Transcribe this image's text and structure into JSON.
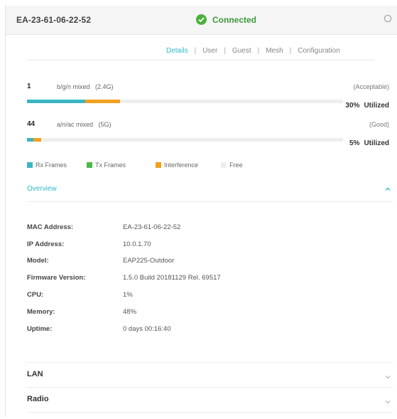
{
  "header": {
    "device_name": "EA-23-61-06-22-52",
    "status": "Connected",
    "status_color": "#4ab03a"
  },
  "tabs": [
    {
      "label": "Details",
      "active": true
    },
    {
      "label": "User",
      "active": false
    },
    {
      "label": "Guest",
      "active": false
    },
    {
      "label": "Mesh",
      "active": false
    },
    {
      "label": "Configuration",
      "active": false
    }
  ],
  "radios": [
    {
      "channel": "1",
      "mode": "b/g/n mixed",
      "band": "(2.4G)",
      "quality": "(Acceptable)",
      "utilization": "30%",
      "utilized_label": "Utilized",
      "rx_fraction": 0.185,
      "tx_fraction": 0.0,
      "interference_fraction": 0.11
    },
    {
      "channel": "44",
      "mode": "a/n/ac mixed",
      "band": "(5G)",
      "quality": "(Good)",
      "utilization": "5%",
      "utilized_label": "Utilized",
      "rx_fraction": 0.02,
      "tx_fraction": 0.0,
      "interference_fraction": 0.025
    }
  ],
  "legend": [
    {
      "label": "Rx Frames",
      "color": "#3bb5c4"
    },
    {
      "label": "Tx Frames",
      "color": "#4cb84a"
    },
    {
      "label": "Interference",
      "color": "#f2a01f"
    },
    {
      "label": "Free",
      "color": "#eeeeee"
    }
  ],
  "overview": {
    "title": "Overview",
    "fields": [
      {
        "key": "MAC Address:",
        "value": "EA-23-61-06-22-52"
      },
      {
        "key": "IP Address:",
        "value": "10.0.1.70"
      },
      {
        "key": "Model:",
        "value": "EAP225-Outdoor"
      },
      {
        "key": "Firmware Version:",
        "value": "1.5.0 Build 20181129 Rel. 69517"
      },
      {
        "key": "CPU:",
        "value": "1%"
      },
      {
        "key": "Memory:",
        "value": "48%"
      },
      {
        "key": "Uptime:",
        "value": "0 days 00:16:40"
      }
    ]
  },
  "sections": [
    {
      "label": "LAN"
    },
    {
      "label": "Radio"
    }
  ],
  "accent_color": "#2fb8c8"
}
